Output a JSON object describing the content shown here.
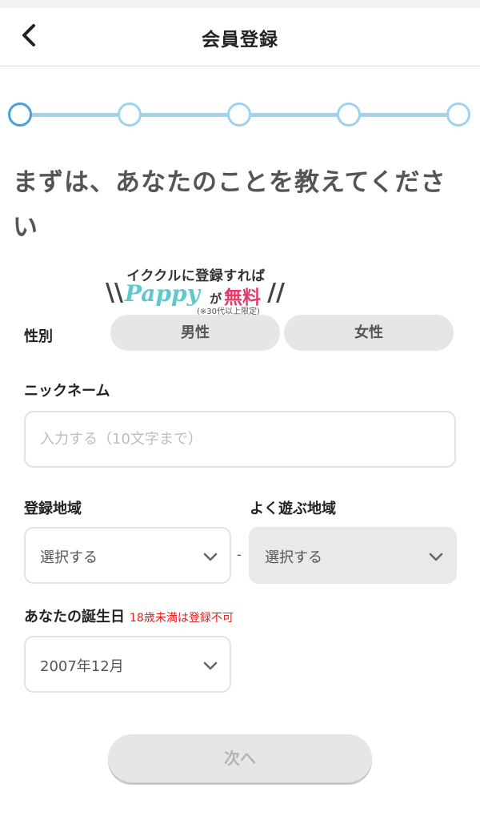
{
  "header": {
    "title": "会員登録",
    "back_icon": "chevron-left-icon"
  },
  "progress": {
    "total_steps": 5,
    "current_step": 1,
    "colors": {
      "active": "#4aa0dc",
      "inactive": "#9fd2ee"
    }
  },
  "headline": "まずは、あなたのことを教えてください",
  "promo": {
    "top_text": "イククルに登録すれば",
    "brand": "Pappy",
    "connector": "が",
    "highlight": "無料",
    "note": "(※30代以上限定)",
    "colors": {
      "brand": "#5ec8cc",
      "highlight": "#e33c6b"
    }
  },
  "gender": {
    "label": "性別",
    "options": [
      "男性",
      "女性"
    ]
  },
  "nickname": {
    "label": "ニックネーム",
    "value": "",
    "placeholder": "入力する（10文字まで）"
  },
  "region": {
    "label": "登録地域",
    "value": "選択する"
  },
  "frequent_region": {
    "label": "よく遊ぶ地域",
    "value": "選択する",
    "disabled": true
  },
  "separator": "-",
  "birthday": {
    "label": "あなたの誕生日",
    "note": "18歳未満は登録不可",
    "value": "2007年12月",
    "note_color": "#e02020"
  },
  "next_button": {
    "label": "次へ",
    "disabled": true
  }
}
